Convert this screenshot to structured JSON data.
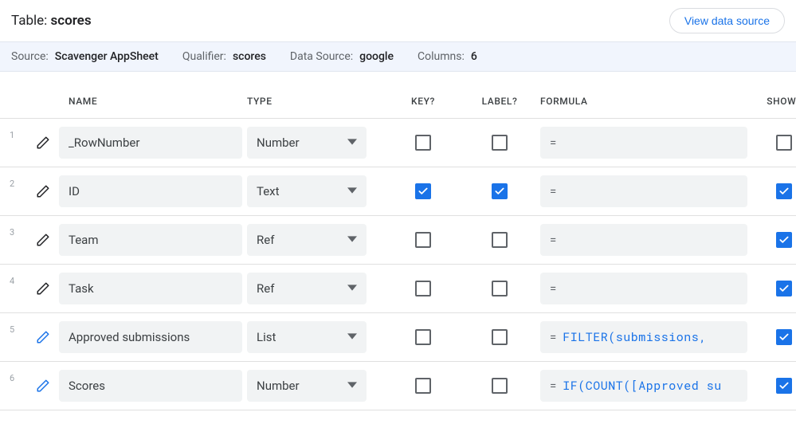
{
  "header": {
    "title_label": "Table:",
    "title_value": "scores",
    "view_button": "View data source"
  },
  "meta": {
    "source_label": "Source:",
    "source_value": "Scavenger AppSheet",
    "qualifier_label": "Qualifier:",
    "qualifier_value": "scores",
    "datasource_label": "Data Source:",
    "datasource_value": "google",
    "columns_label": "Columns:",
    "columns_value": "6"
  },
  "columns_header": {
    "name": "NAME",
    "type": "TYPE",
    "key": "KEY?",
    "label": "LABEL?",
    "formula": "FORMULA",
    "show": "SHOW?"
  },
  "rows": [
    {
      "num": "1",
      "virtual": false,
      "name": "_RowNumber",
      "type": "Number",
      "key": false,
      "label": false,
      "formula": "",
      "show": false
    },
    {
      "num": "2",
      "virtual": false,
      "name": "ID",
      "type": "Text",
      "key": true,
      "label": true,
      "formula": "",
      "show": true
    },
    {
      "num": "3",
      "virtual": false,
      "name": "Team",
      "type": "Ref",
      "key": false,
      "label": false,
      "formula": "",
      "show": true
    },
    {
      "num": "4",
      "virtual": false,
      "name": "Task",
      "type": "Ref",
      "key": false,
      "label": false,
      "formula": "",
      "show": true
    },
    {
      "num": "5",
      "virtual": true,
      "name": "Approved submissions",
      "type": "List",
      "key": false,
      "label": false,
      "formula": "FILTER(submissions,",
      "show": true
    },
    {
      "num": "6",
      "virtual": true,
      "name": "Scores",
      "type": "Number",
      "key": false,
      "label": false,
      "formula": "IF(COUNT([Approved su",
      "show": true
    }
  ]
}
